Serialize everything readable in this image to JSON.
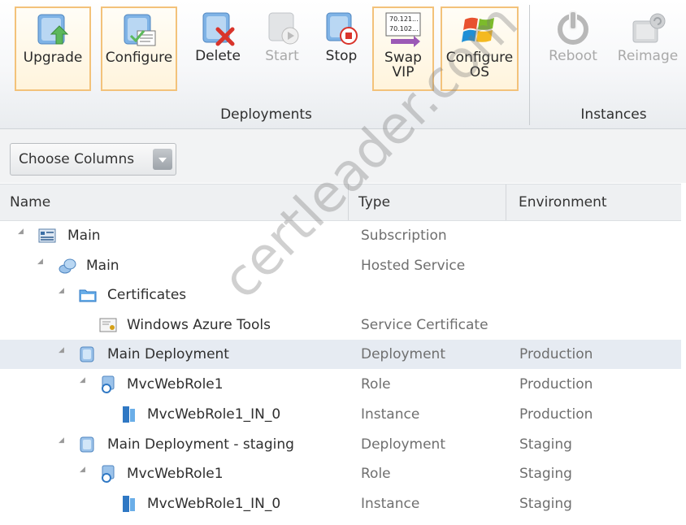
{
  "ribbon": {
    "buttons": {
      "upgrade": "Upgrade",
      "configure": "Configure",
      "delete": "Delete",
      "start": "Start",
      "stop": "Stop",
      "swap_vip": "Swap\nVIP",
      "swap_vip_icon_text": "70.121...\n70.102...",
      "configure_os": "Configure\nOS",
      "reboot": "Reboot",
      "reimage": "Reimage"
    },
    "groups": {
      "deployments": "Deployments",
      "instances": "Instances"
    }
  },
  "toolbar": {
    "choose_columns": "Choose Columns"
  },
  "grid": {
    "columns": {
      "name": "Name",
      "type": "Type",
      "environment": "Environment"
    },
    "rows": [
      {
        "name": "Main",
        "type": "Subscription",
        "environment": ""
      },
      {
        "name": "Main",
        "type": "Hosted Service",
        "environment": ""
      },
      {
        "name": "Certificates",
        "type": "",
        "environment": ""
      },
      {
        "name": "Windows Azure Tools",
        "type": "Service Certificate",
        "environment": ""
      },
      {
        "name": "Main Deployment",
        "type": "Deployment",
        "environment": "Production"
      },
      {
        "name": "MvcWebRole1",
        "type": "Role",
        "environment": "Production"
      },
      {
        "name": "MvcWebRole1_IN_0",
        "type": "Instance",
        "environment": "Production"
      },
      {
        "name": "Main Deployment - staging",
        "type": "Deployment",
        "environment": "Staging"
      },
      {
        "name": "MvcWebRole1",
        "type": "Role",
        "environment": "Staging"
      },
      {
        "name": "MvcWebRole1_IN_0",
        "type": "Instance",
        "environment": "Staging"
      }
    ]
  },
  "watermark": "certleader.com",
  "colors": {
    "highlight_border": "#f3c27a",
    "selected_row": "#e6ebf2"
  }
}
